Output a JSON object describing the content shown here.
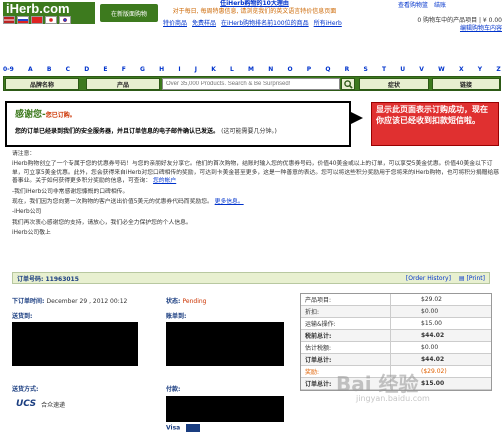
{
  "header": {
    "logo": "iHerb.com",
    "flags": [
      "us",
      "ru",
      "cn",
      "jp",
      "kr"
    ],
    "cn_button": "在新版面购物",
    "promo_line1": "任iHerb购物的10大理由",
    "promo_line2": "对于每日, 每周特惠信息, 请浏览我们的英文语言特价信息页面",
    "top_nav": [
      "特价商品",
      "免费样品",
      "在iHerb购物排名前100位的商品",
      "所有iHerb"
    ],
    "account_links": [
      "查看购物篮",
      "结账"
    ],
    "cart_summary": "0 购物车中的产品项目 | ¥ 0.00",
    "cart_edit": "编辑购物车内容"
  },
  "alphabet": [
    "0-9",
    "A",
    "B",
    "C",
    "D",
    "E",
    "F",
    "G",
    "H",
    "I",
    "J",
    "K",
    "L",
    "M",
    "N",
    "O",
    "P",
    "Q",
    "R",
    "S",
    "T",
    "U",
    "V",
    "W",
    "X",
    "Y",
    "Z"
  ],
  "searchbar": {
    "tab_brands": "品牌名称",
    "tab_products": "产品",
    "search_placeholder": "Over 35,000 Products. Search & Be Surprised!",
    "tab_ailments": "症状",
    "tab_links": "链接"
  },
  "thanks": {
    "title": "感谢您-",
    "title_small": "您已订购。",
    "message": "您的订单已经录到我们的安全服务器，并且订单信息的电子邮件确认已发送。",
    "message_note": "(这可能需要几分钟。)"
  },
  "callout": "显示此页面表示订购成功，现在你应该已经收到扣款短信啦。",
  "body": {
    "p1": "请注意：",
    "p2": "iHerb购物创立了一个专属于您的优惠券号码！与您的亲朋好友分享它。他们的首次购物，结账时输入您的优惠券号码，价值40美金或以上的订单，可以享受5美金优惠。价值40美金以下订单，可立享5美金优惠。此外，您会获得来自iHerb对您口碑相传的奖励，可达到卡美金甚至更多，这是一种善意的表达。您可以将这些积分奖励用于您将来的iHerb购物，也可将积分捐赠给慈善事业。",
    "p2_link": "关于如何获得更多积分奖励的信息，可查询：",
    "p2_link2": "您的帐户",
    "p3": "-我们iHerb公司非常感谢您慷慨的口碑相传。",
    "p4": "现在，我们因为您向第一次购物的客户送出价值5美元的优惠券代码而奖励您。",
    "p4_link": "更多信息。",
    "p5": "-iHerb公司",
    "p6": "我们再次衷心感谢您的支持，请放心，我们必全力保护您的个人信息。",
    "p7": "iHerb公司敬上"
  },
  "order": {
    "number_label": "订单号码: 11963015",
    "history_link": "[Order History]",
    "print_link": "[Print]",
    "date_label": "下订单时间:",
    "date_value": "December 29 , 2012 00:12",
    "status_label": "状态:",
    "status_value": "Pending",
    "ship_to_label": "送货到:",
    "bill_to_label": "账单到:",
    "ship_method_label": "送货方式:",
    "ship_carrier_logo": "UCS",
    "ship_carrier": "合众速递",
    "payment_label": "付款:",
    "payment_card": "Visa"
  },
  "totals": [
    {
      "label": "产品项目:",
      "value": "$29.02",
      "style": ""
    },
    {
      "label": "折扣:",
      "value": "$0.00",
      "style": ""
    },
    {
      "label": "运输&操作:",
      "value": "$15.00",
      "style": ""
    },
    {
      "label": "税前总计:",
      "value": "$44.02",
      "style": "bold"
    },
    {
      "label": "估计税额:",
      "value": "$0.00",
      "style": ""
    },
    {
      "label": "订单总计:",
      "value": "$44.02",
      "style": "bold"
    },
    {
      "label": "奖励:",
      "value": "($29.02)",
      "style": "disc"
    },
    {
      "label": "订单总计:",
      "value": "$15.00",
      "style": "bold"
    }
  ],
  "watermark": "Bai 经验",
  "watermark_url": "jingyan.baidu.com",
  "colors": {
    "brand_green": "#3d7a1e",
    "callout_red": "#e03030",
    "link_blue": "#0033cc"
  }
}
